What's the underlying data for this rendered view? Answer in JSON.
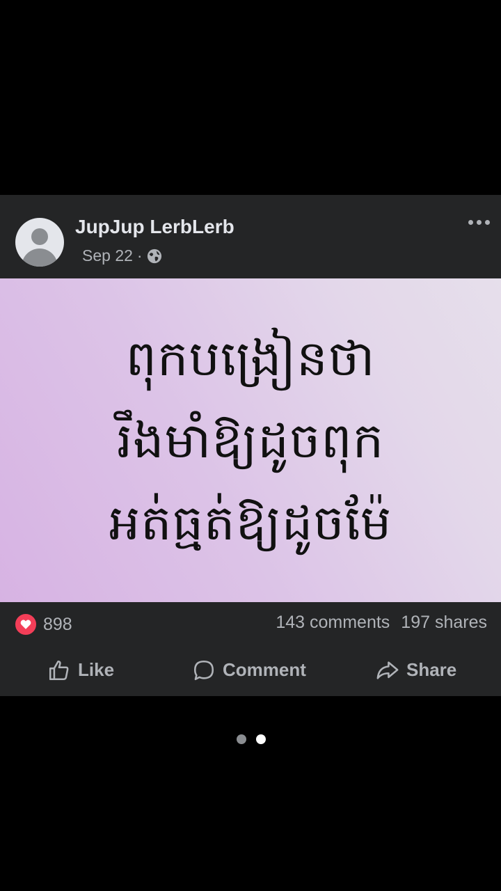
{
  "post": {
    "author": "JupJup LerbLerb",
    "date": "Sep 22",
    "separator": "·",
    "privacy_icon": "globe-icon",
    "more_icon": "more-horizontal-icon",
    "image_text": [
      "ពុកបង្រៀនថា",
      "រឹងមាំឱ្យដូចពុក",
      "អត់ធ្មត់ឱ្យដូចម៉ែ"
    ]
  },
  "stats": {
    "reaction_icon": "love-reaction-icon",
    "reaction_count": "898",
    "comments": "143 comments",
    "shares": "197 shares"
  },
  "actions": {
    "like": "Like",
    "comment": "Comment",
    "share": "Share"
  },
  "carousel": {
    "total": 2,
    "active_index": 1
  },
  "colors": {
    "background": "#000000",
    "card": "#242526",
    "secondary_text": "#b0b3b8",
    "primary_text": "#e4e6eb",
    "love": "#f33e58"
  }
}
